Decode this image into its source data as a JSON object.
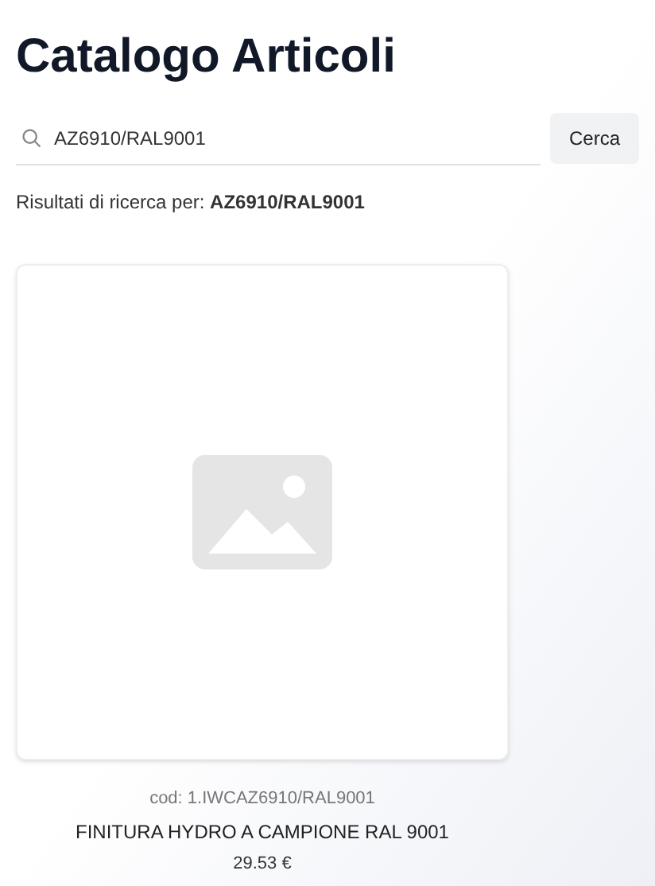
{
  "title": "Catalogo Articoli",
  "search": {
    "value": "AZ6910/RAL9001",
    "button": "Cerca"
  },
  "results_text": "Risultati di ricerca per: **AZ6910/RAL9001**",
  "products": [
    {
      "code": "cod: 1.IWCAZ6910/RAL9001",
      "name": "FINITURA HYDRO A CAMPIONE RAL 9001",
      "price": "29.53 €"
    }
  ]
}
